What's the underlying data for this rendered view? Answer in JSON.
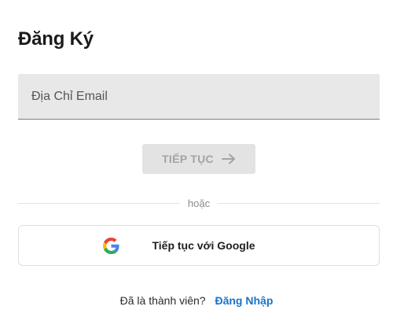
{
  "header": {
    "title": "Đăng Ký"
  },
  "email": {
    "placeholder": "Địa Chỉ Email",
    "value": ""
  },
  "continue_button": {
    "label": "TIẾP TỤC",
    "icon": "arrow-right-icon",
    "enabled": false
  },
  "divider": {
    "label": "hoặc"
  },
  "google_button": {
    "label": "Tiếp tục với Google",
    "icon": "google-icon"
  },
  "signin": {
    "prompt": "Đã là thành viên?",
    "link_label": "Đăng Nhập"
  },
  "colors": {
    "link": "#1a73c8",
    "disabled_button_bg": "#e3e3e3",
    "disabled_button_text": "#a3a3a3",
    "input_bg": "#e8e8e8"
  }
}
